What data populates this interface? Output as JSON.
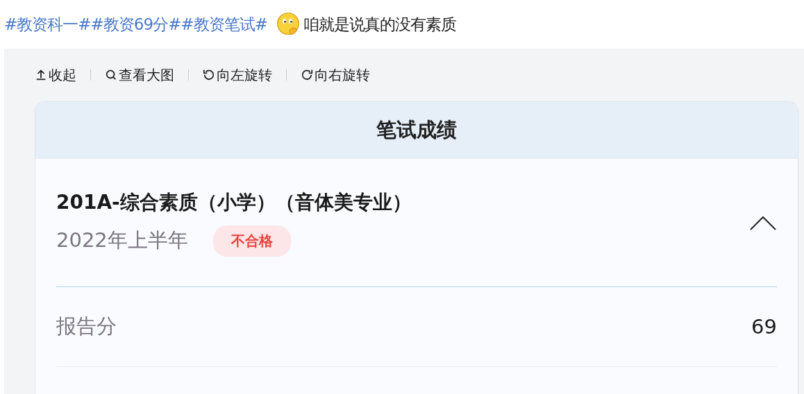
{
  "post": {
    "tags": [
      "#教资科一#",
      "#教资69分#",
      "#教资笔试#"
    ],
    "text": "咱就是说真的没有素质"
  },
  "toolbar": [
    {
      "kind": "collapse",
      "label": "收起"
    },
    {
      "kind": "zoom",
      "label": "查看大图"
    },
    {
      "kind": "rotate-left",
      "label": "向左旋转"
    },
    {
      "kind": "rotate-right",
      "label": "向右旋转"
    }
  ],
  "card": {
    "title": "笔试成绩",
    "subject": "201A-综合素质（小学）（音体美专业）",
    "term": "2022年上半年",
    "status": "不合格",
    "expanded": true,
    "rows": [
      {
        "label": "报告分",
        "value": "69"
      }
    ]
  }
}
